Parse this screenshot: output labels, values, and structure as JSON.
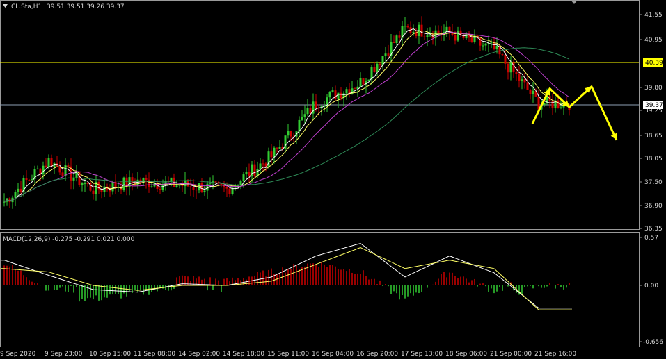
{
  "window": {
    "title": "CL.Sta,H1",
    "ohlc": "39.51 39.51 39.26 39.37"
  },
  "price_axis": {
    "ticks": [
      "41.55",
      "40.95",
      "39.80",
      "39.25",
      "38.65",
      "38.05",
      "37.50",
      "36.90",
      "36.35"
    ],
    "line_tag": "40.39",
    "current_tag": "39.37"
  },
  "macd": {
    "label": "MACD(12,26,9) -0.275 -0.291 0.021 0.000",
    "ticks": [
      "0.57",
      "0.00",
      "-0.656"
    ]
  },
  "time_axis": {
    "labels": [
      "9 Sep 2020",
      "9 Sep 23:00",
      "10 Sep 15:00",
      "11 Sep 08:00",
      "14 Sep 02:00",
      "14 Sep 18:00",
      "15 Sep 11:00",
      "16 Sep 04:00",
      "16 Sep 20:00",
      "17 Sep 13:00",
      "18 Sep 06:00",
      "21 Sep 00:00",
      "21 Sep 16:00"
    ]
  },
  "colors": {
    "background": "#000000",
    "bull": "#32cd32",
    "bear": "#cc0000",
    "ma_fast": "#ffffff",
    "ma_mid": "#ffff66",
    "ma_slow": "#c040d0",
    "ma_long": "#2e8b57",
    "level_line": "#ffff00",
    "price_line": "#8ea0b4",
    "arrows": "#ffff00",
    "macd_line": "#ffffff",
    "signal_line": "#ffff66"
  },
  "chart_data": {
    "type": "candlestick",
    "symbol": "CL.Sta",
    "timeframe": "H1",
    "x": [
      "9 Sep 2020",
      "9 Sep 23:00",
      "10 Sep 15:00",
      "11 Sep 08:00",
      "14 Sep 02:00",
      "14 Sep 18:00",
      "15 Sep 11:00",
      "16 Sep 04:00",
      "16 Sep 20:00",
      "17 Sep 13:00",
      "18 Sep 06:00",
      "21 Sep 00:00",
      "21 Sep 16:00"
    ],
    "price_anchors": [
      37.0,
      38.0,
      37.3,
      37.5,
      37.4,
      37.3,
      38.1,
      39.4,
      39.9,
      41.2,
      41.1,
      40.7,
      39.4
    ],
    "ylim": [
      36.35,
      41.75
    ],
    "horizontal_lines": [
      40.39
    ],
    "last_price": 39.37,
    "projection": [
      [
        38.9,
        39.75,
        39.3,
        39.8,
        38.5
      ]
    ],
    "macd_anchors": [
      0.3,
      0.12,
      -0.05,
      -0.08,
      0.02,
      0.0,
      0.1,
      0.35,
      0.5,
      0.1,
      0.35,
      0.15,
      -0.27
    ],
    "signal_anchors": [
      0.2,
      0.16,
      0.0,
      -0.06,
      0.0,
      0.0,
      0.05,
      0.25,
      0.45,
      0.2,
      0.3,
      0.2,
      -0.29
    ],
    "macd_ylim": [
      -0.656,
      0.57
    ]
  }
}
